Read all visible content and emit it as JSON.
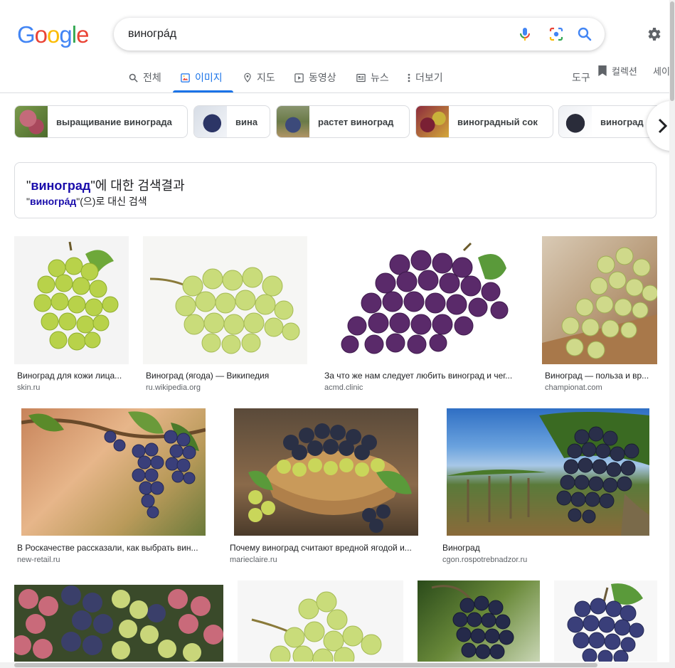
{
  "logo": {
    "letters": [
      "G",
      "o",
      "o",
      "g",
      "l",
      "e"
    ],
    "colors": [
      "#4285F4",
      "#EA4335",
      "#FBBC05",
      "#4285F4",
      "#34A853",
      "#EA4335"
    ]
  },
  "search": {
    "query": "виногрáд"
  },
  "tabs": [
    {
      "label": "전체",
      "icon": "search-icon"
    },
    {
      "label": "이미지",
      "icon": "image-icon",
      "active": true
    },
    {
      "label": "지도",
      "icon": "map-pin-icon"
    },
    {
      "label": "동영상",
      "icon": "video-icon"
    },
    {
      "label": "뉴스",
      "icon": "news-icon"
    },
    {
      "label": "더보기",
      "icon": "more-vert-icon"
    }
  ],
  "tools_label": "도구",
  "collections_label": "컬렉션",
  "safesearch_label": "세이",
  "chips": [
    {
      "label": "выращивание винограда"
    },
    {
      "label": "вина"
    },
    {
      "label": "растет виноград"
    },
    {
      "label": "виноградный сок"
    },
    {
      "label": "виноград"
    }
  ],
  "spelling": {
    "q_open": "\"",
    "corrected": "виноград",
    "q_close": "\"",
    "showing_suffix": "에 대한 검색결과",
    "original": "виногрáд",
    "instead_suffix": "(으)로 대신 검색"
  },
  "results": [
    {
      "title": "Виноград для кожи лица...",
      "source": "skin.ru"
    },
    {
      "title": "Виноград (ягода) — Википедия",
      "source": "ru.wikipedia.org"
    },
    {
      "title": "За что же нам следует любить виноград и чег...",
      "source": "acmd.clinic"
    },
    {
      "title": "Виноград — польза и вр...",
      "source": "championat.com"
    },
    {
      "title": "В Роскачестве рассказали, как выбрать вин...",
      "source": "new-retail.ru"
    },
    {
      "title": "Почему виноград считают вредной ягодой и...",
      "source": "marieclaire.ru"
    },
    {
      "title": "Виноград",
      "source": "cgon.rospotrebnadzor.ru"
    },
    {
      "title": "",
      "source": ""
    },
    {
      "title": "",
      "source": ""
    },
    {
      "title": "",
      "source": ""
    },
    {
      "title": "",
      "source": ""
    }
  ],
  "colors": {
    "accent": "#1a73e8",
    "link_bold": "#1a0dab",
    "text_secondary": "#5f6368"
  }
}
